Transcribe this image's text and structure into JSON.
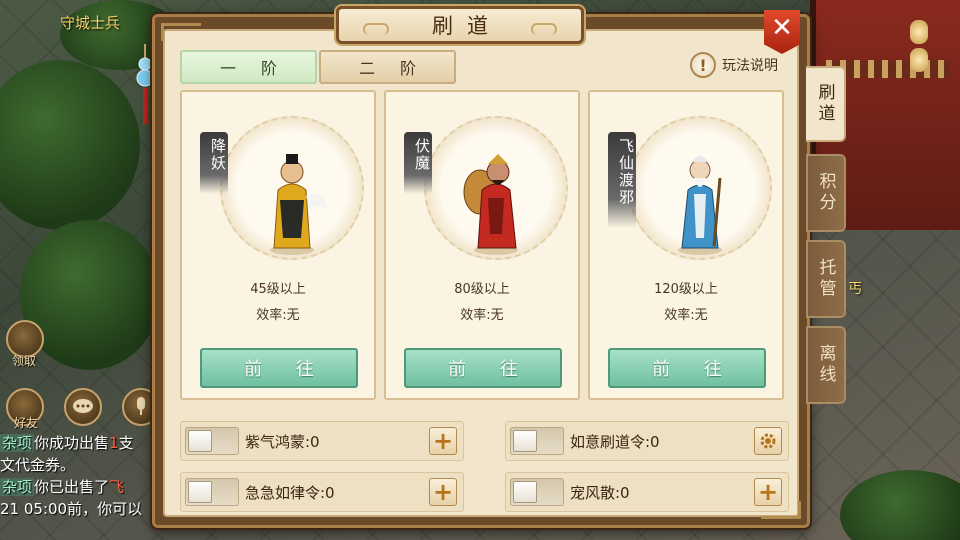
{
  "panel": {
    "title": "刷道",
    "close_icon": "close-icon",
    "rules_label": "玩法说明",
    "tier_tabs": [
      "一 阶",
      "二 阶"
    ],
    "cards": [
      {
        "name": "降妖",
        "level": "45级以上",
        "efficiency": "效率:无",
        "button": "前 往",
        "robe_color": "#e0a81c"
      },
      {
        "name": "伏魔",
        "level": "80级以上",
        "efficiency": "效率:无",
        "button": "前 往",
        "robe_color": "#c42a22"
      },
      {
        "name": "飞仙渡邪",
        "level": "120级以上",
        "efficiency": "效率:无",
        "button": "前 往",
        "robe_color": "#3f93c8"
      }
    ],
    "side_tabs": [
      "刷道",
      "积分",
      "托管",
      "离线"
    ],
    "items": [
      {
        "name": "紫气鸿蒙:0",
        "action_icon": "plus-icon"
      },
      {
        "name": "如意刷道令:0",
        "action_icon": "gear-icon"
      },
      {
        "name": "急急如律令:0",
        "action_icon": "plus-icon"
      },
      {
        "name": "宠风散:0",
        "action_icon": "plus-icon"
      }
    ]
  },
  "world": {
    "npc_name": "守城士兵",
    "beggar_name": "丐",
    "buttons": [
      "领取",
      "好友"
    ]
  },
  "chat": [
    {
      "tag": "杂项",
      "text": "你成功出售",
      "highlight": "1",
      "rest": "支"
    },
    {
      "tag": "",
      "text": "文代金券。",
      "highlight": "",
      "rest": ""
    },
    {
      "tag": "杂项",
      "text": "你已出售了",
      "highlight": "飞",
      "rest": ""
    },
    {
      "tag": "",
      "text": "21 05:00前，你可以",
      "highlight": "",
      "rest": ""
    }
  ]
}
